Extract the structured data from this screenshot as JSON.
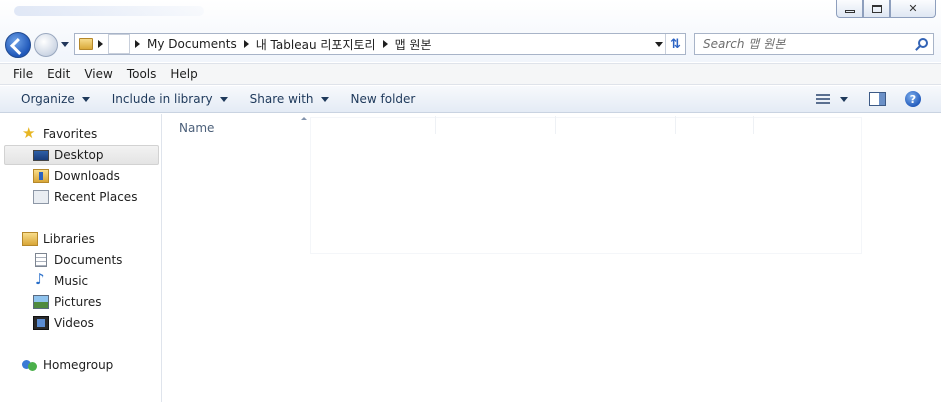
{
  "window": {
    "controls": {
      "minimize": "minimize",
      "maximize": "maximize",
      "close": "✕"
    }
  },
  "address_bar": {
    "segments": [
      "My Documents",
      "내 Tableau 리포지토리",
      "맵 원본"
    ]
  },
  "search": {
    "placeholder": "Search 맵 원본"
  },
  "menu": {
    "items": [
      "File",
      "Edit",
      "View",
      "Tools",
      "Help"
    ]
  },
  "command_bar": {
    "organize": "Organize",
    "include_in_library": "Include in library",
    "share_with": "Share with",
    "new_folder": "New folder",
    "help_glyph": "?"
  },
  "nav_pane": {
    "favorites": {
      "label": "Favorites",
      "items": [
        "Desktop",
        "Downloads",
        "Recent Places"
      ]
    },
    "libraries": {
      "label": "Libraries",
      "items": [
        "Documents",
        "Music",
        "Pictures",
        "Videos"
      ]
    },
    "homegroup": "Homegroup",
    "selected": "Desktop"
  },
  "content": {
    "column_name": "Name"
  }
}
